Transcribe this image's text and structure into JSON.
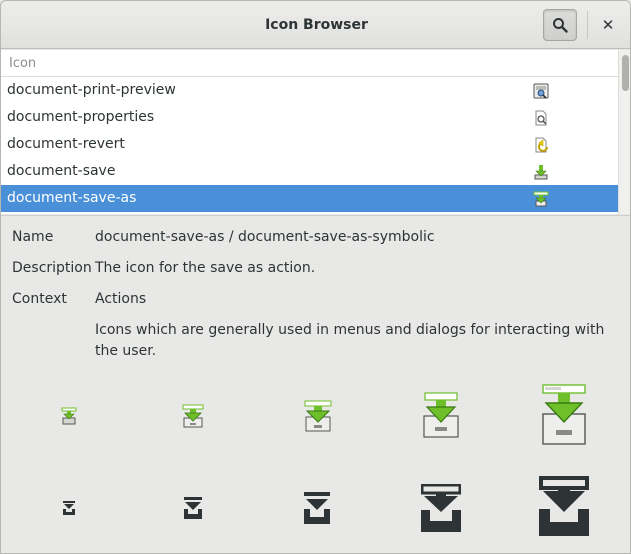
{
  "window": {
    "title": "Icon Browser"
  },
  "header": {
    "search_icon": "search-icon",
    "close_icon": "close-icon",
    "close_glyph": "✕"
  },
  "list": {
    "column_header": "Icon",
    "rows": [
      {
        "name": "document-print-preview",
        "icon": "document-print-preview-icon",
        "selected": false
      },
      {
        "name": "document-properties",
        "icon": "document-properties-icon",
        "selected": false
      },
      {
        "name": "document-revert",
        "icon": "document-revert-icon",
        "selected": false
      },
      {
        "name": "document-save",
        "icon": "document-save-icon",
        "selected": false
      },
      {
        "name": "document-save-as",
        "icon": "document-save-as-icon",
        "selected": true
      }
    ]
  },
  "details": {
    "name_label": "Name",
    "name_value": "document-save-as / document-save-as-symbolic",
    "description_label": "Description",
    "description_value": "The icon for the save as action.",
    "context_label": "Context",
    "context_value": "Actions",
    "context_description": "Icons which are generally used in menus and dialogs for interacting with the user."
  },
  "colors": {
    "selection": "#4a90d9",
    "icon_green": "#6fbf2a",
    "symbolic_dark": "#2e3436"
  }
}
